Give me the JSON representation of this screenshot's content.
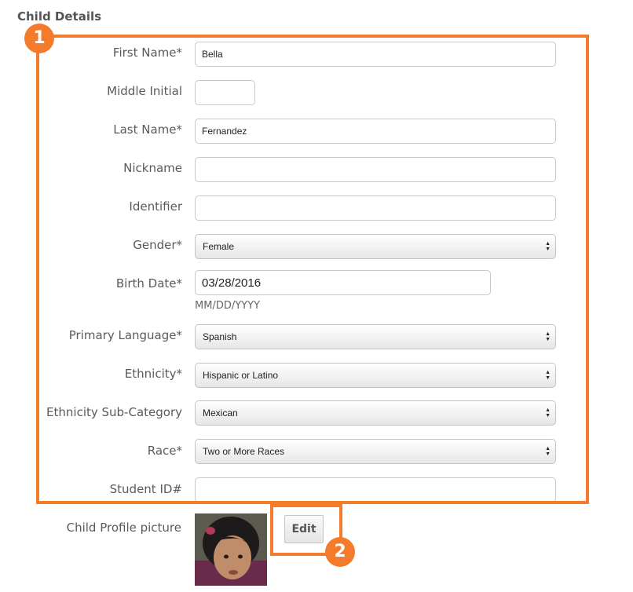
{
  "section_title": "Child Details",
  "badges": {
    "one": "1",
    "two": "2"
  },
  "fields": {
    "first_name": {
      "label": "First Name*",
      "value": "Bella"
    },
    "middle_initial": {
      "label": "Middle Initial",
      "value": ""
    },
    "last_name": {
      "label": "Last Name*",
      "value": "Fernandez"
    },
    "nickname": {
      "label": "Nickname",
      "value": ""
    },
    "identifier": {
      "label": "Identifier",
      "value": ""
    },
    "gender": {
      "label": "Gender*",
      "value": "Female"
    },
    "birth_date": {
      "label": "Birth Date*",
      "value": "03/28/2016",
      "hint": "MM/DD/YYYY"
    },
    "primary_language": {
      "label": "Primary Language*",
      "value": "Spanish"
    },
    "ethnicity": {
      "label": "Ethnicity*",
      "value": "Hispanic or Latino"
    },
    "ethnicity_sub": {
      "label": "Ethnicity Sub-Category",
      "value": "Mexican"
    },
    "race": {
      "label": "Race*",
      "value": "Two or More Races"
    },
    "student_id": {
      "label": "Student ID#",
      "value": ""
    }
  },
  "profile_picture": {
    "label": "Child Profile picture",
    "edit_label": "Edit"
  },
  "colors": {
    "highlight": "#f47b2b"
  }
}
